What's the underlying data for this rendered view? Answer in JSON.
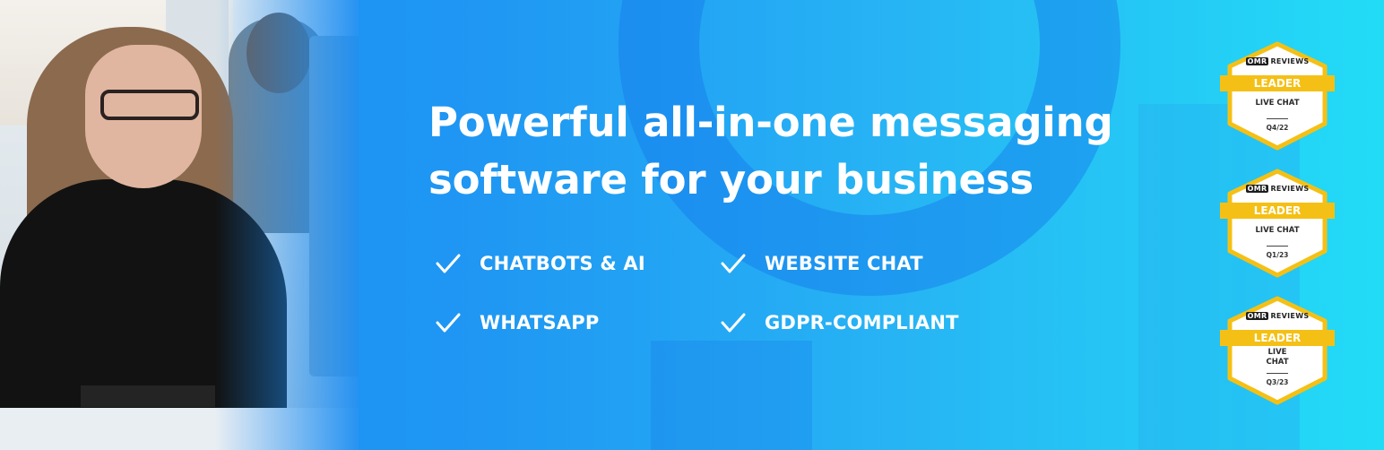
{
  "headline": {
    "line1": "Powerful all-in-one messaging",
    "line2": "software for your business"
  },
  "features": [
    {
      "label": "CHATBOTS & AI",
      "icon": "check-icon"
    },
    {
      "label": "WEBSITE CHAT",
      "icon": "check-icon"
    },
    {
      "label": "WHATSAPP",
      "icon": "check-icon"
    },
    {
      "label": "GDPR-COMPLIANT",
      "icon": "check-icon"
    }
  ],
  "badges": [
    {
      "brand_mark": "OMR",
      "brand_text": "REVIEWS",
      "ribbon": "LEADER",
      "category": "LIVE CHAT",
      "period": "Q4/22"
    },
    {
      "brand_mark": "OMR",
      "brand_text": "REVIEWS",
      "ribbon": "LEADER",
      "category": "LIVE CHAT",
      "period": "Q1/23"
    },
    {
      "brand_mark": "OMR",
      "brand_text": "REVIEWS",
      "ribbon": "LEADER",
      "category": "LIVE\nCHAT",
      "period": "Q3/23"
    }
  ],
  "colors": {
    "gradient_start": "#1b8df2",
    "gradient_end": "#22dcf6",
    "text": "#ffffff",
    "badge_ribbon": "#f5c015",
    "badge_border": "#f5c015"
  }
}
